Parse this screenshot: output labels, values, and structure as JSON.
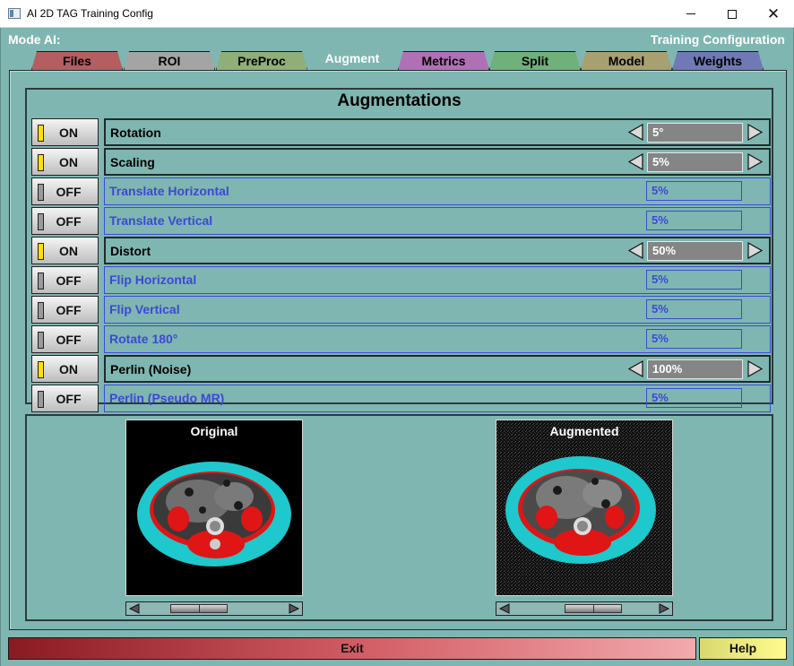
{
  "window": {
    "title": "AI 2D TAG Training Config"
  },
  "header": {
    "mode_label": "Mode AI:",
    "config_label": "Training Configuration"
  },
  "tabs": [
    {
      "label": "Files",
      "color": "#b45e62"
    },
    {
      "label": "ROI",
      "color": "#a4a4a4"
    },
    {
      "label": "PreProc",
      "color": "#8fae78"
    },
    {
      "label": "Augment",
      "color": "#7fb6b1"
    },
    {
      "label": "Metrics",
      "color": "#b070b6"
    },
    {
      "label": "Split",
      "color": "#70b07a"
    },
    {
      "label": "Model",
      "color": "#a8a070"
    },
    {
      "label": "Weights",
      "color": "#7079b6"
    }
  ],
  "active_tab": "Augment",
  "augmentations": {
    "title": "Augmentations",
    "rows": [
      {
        "state": "ON",
        "name": "Rotation",
        "value": "5°",
        "enabled": true
      },
      {
        "state": "ON",
        "name": "Scaling",
        "value": "5%",
        "enabled": true
      },
      {
        "state": "OFF",
        "name": "Translate Horizontal",
        "value": "5%",
        "enabled": false
      },
      {
        "state": "OFF",
        "name": "Translate Vertical",
        "value": "5%",
        "enabled": false
      },
      {
        "state": "ON",
        "name": "Distort",
        "value": "50%",
        "enabled": true
      },
      {
        "state": "OFF",
        "name": "Flip Horizontal",
        "value": "5%",
        "enabled": false
      },
      {
        "state": "OFF",
        "name": "Flip Vertical",
        "value": "5%",
        "enabled": false
      },
      {
        "state": "OFF",
        "name": "Rotate 180°",
        "value": "5%",
        "enabled": false
      },
      {
        "state": "ON",
        "name": "Perlin (Noise)",
        "value": "100%",
        "enabled": true
      },
      {
        "state": "OFF",
        "name": "Perlin (Pseudo MR)",
        "value": "5%",
        "enabled": false
      }
    ]
  },
  "previews": {
    "original_label": "Original",
    "augmented_label": "Augmented",
    "original_scroll_position": 0.33,
    "augmented_scroll_position": 0.6
  },
  "footer": {
    "exit_label": "Exit",
    "help_label": "Help"
  },
  "colors": {
    "panel_bg": "#7fb6b1",
    "led_on": "#ffe100",
    "disabled_text": "#3d48d8",
    "fat": "#1ec8cc",
    "muscle": "#e01515"
  }
}
